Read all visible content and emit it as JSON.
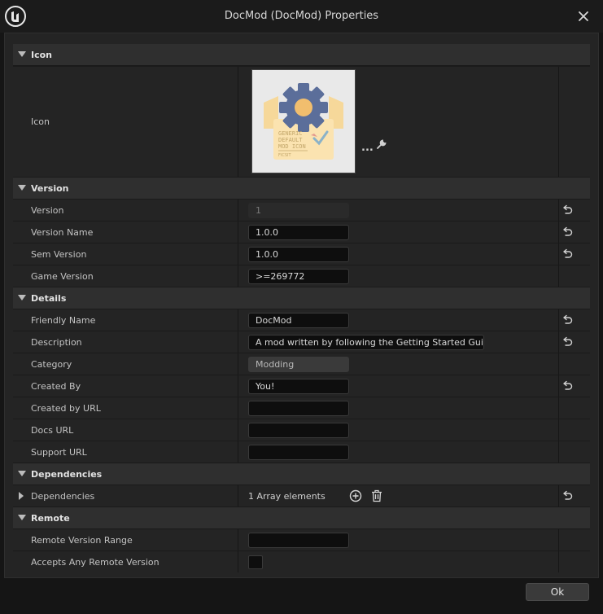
{
  "window": {
    "title": "DocMod (DocMod) Properties"
  },
  "sections": {
    "icon": {
      "label": "Icon",
      "row_label": "Icon",
      "thumb_text": [
        "GENERIC",
        "DEFAULT",
        "MOD ICON"
      ],
      "thumb_brand": "FICSIT",
      "browse_label": "..."
    },
    "version": {
      "label": "Version",
      "rows": [
        {
          "label": "Version",
          "value": "1"
        },
        {
          "label": "Version Name",
          "value": "1.0.0"
        },
        {
          "label": "Sem Version",
          "value": "1.0.0"
        },
        {
          "label": "Game Version",
          "value": ">=269772"
        }
      ]
    },
    "details": {
      "label": "Details",
      "rows": [
        {
          "label": "Friendly Name",
          "value": "DocMod"
        },
        {
          "label": "Description",
          "value": "A mod written by following the Getting Started Guide."
        },
        {
          "label": "Category",
          "value": "Modding"
        },
        {
          "label": "Created By",
          "value": "You!"
        },
        {
          "label": "Created by URL",
          "value": ""
        },
        {
          "label": "Docs URL",
          "value": ""
        },
        {
          "label": "Support URL",
          "value": ""
        }
      ]
    },
    "dependencies": {
      "label": "Dependencies",
      "row_label": "Dependencies",
      "array_text": "1 Array elements"
    },
    "remote": {
      "label": "Remote",
      "rows": [
        {
          "label": "Remote Version Range",
          "value": ""
        },
        {
          "label": "Accepts Any Remote Version",
          "checked": false
        }
      ]
    }
  },
  "footer": {
    "ok_label": "Ok"
  },
  "colors": {
    "background": "#151515",
    "category": "#2f2f2f",
    "row": "#242424",
    "field": "#0e0e0e",
    "icon_gear": "#5b6e9a",
    "icon_box": "#f6d89a"
  }
}
